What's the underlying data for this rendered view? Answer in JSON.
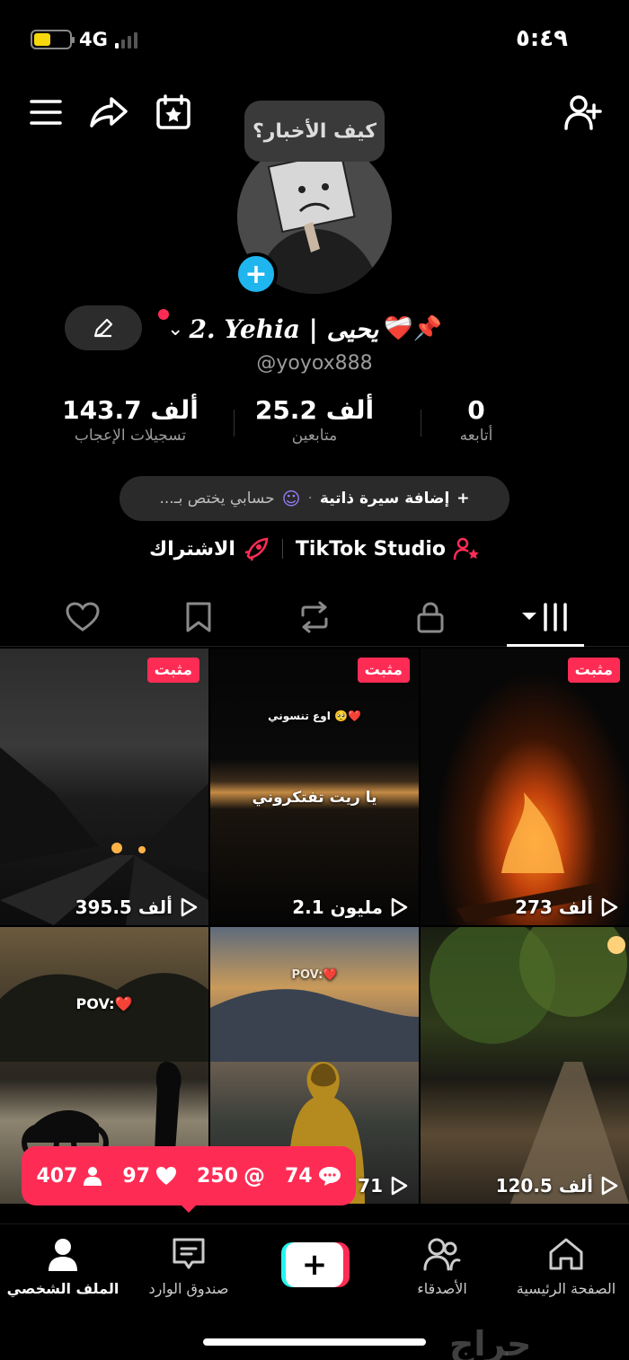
{
  "status": {
    "network": "4G",
    "time": "٥:٤٩"
  },
  "header": {
    "bubble_text": "كيف الأخبار؟"
  },
  "profile": {
    "display_name": "2. Yehia | يحيى",
    "name_emoji": "❤️‍🩹📌",
    "handle": "@yoyox888"
  },
  "stats": [
    {
      "value": "143.7 ألف",
      "label": "تسجيلات الإعجاب"
    },
    {
      "value": "25.2 ألف",
      "label": "متابعين"
    },
    {
      "value": "0",
      "label": "أتابعه"
    }
  ],
  "bio": {
    "add_label": "إضافة سيرة ذاتية",
    "separator": "·",
    "rest": "حسابي يختص بـ..."
  },
  "links": {
    "studio": "TikTok Studio",
    "subscribe": "الاشتراك"
  },
  "colors": {
    "accent": "#fe2c55",
    "cyan": "#25f4ee",
    "avatar_plus": "#1fb6f0"
  },
  "videos": [
    {
      "pinned": "مثبت",
      "views": "395.5 ألف",
      "caption": ""
    },
    {
      "pinned": "مثبت",
      "views": "2.1 مليون",
      "caption": "يا ريت تفتكروني",
      "caption_top": "اوع تنسوني 🥺❤️"
    },
    {
      "pinned": "مثبت",
      "views": "273 ألف",
      "caption": ""
    },
    {
      "pinned": "",
      "views": "",
      "caption": "POV:❤️"
    },
    {
      "pinned": "",
      "views": "71",
      "caption": "POV:❤️"
    },
    {
      "pinned": "",
      "views": "120.5 ألف",
      "caption": ""
    }
  ],
  "activity": {
    "comments": "74",
    "mentions": "250",
    "likes": "97",
    "followers": "407"
  },
  "nav": {
    "home": "الصفحة الرئيسية",
    "friends": "الأصدقاء",
    "inbox": "صندوق الوارد",
    "profile": "الملف الشخصي"
  },
  "watermark": "حراج"
}
